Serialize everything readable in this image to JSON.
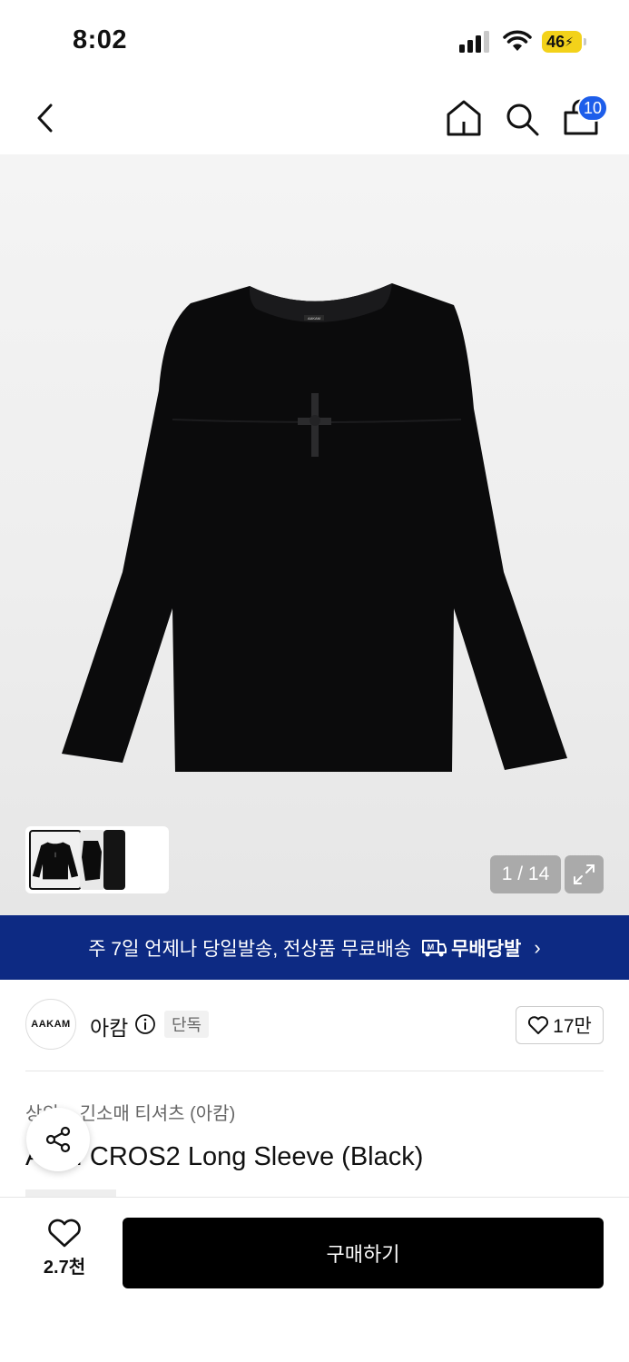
{
  "status_bar": {
    "time": "8:02",
    "battery": "46"
  },
  "nav": {
    "cart_count": "10"
  },
  "gallery": {
    "page_indicator": "1 / 14",
    "shirt_logo": "AAKAM"
  },
  "promo": {
    "text": "주 7일 언제나 당일발송, 전상품 무료배송",
    "badge_label": "무배당발",
    "chevron": "›"
  },
  "brand": {
    "logo_text": "AAKAM",
    "name": "아캄",
    "exclusive_label": "단독",
    "like_count": "17만"
  },
  "product": {
    "breadcrumb": "상의 > 긴소매 티셔츠 (아캄)",
    "title": "AKM CROS2 Long Sleeve (Black)"
  },
  "bottom": {
    "wish_count": "2.7천",
    "buy_label": "구매하기"
  },
  "colors": {
    "accent": "#1e5eea",
    "promo_bg": "#0d2a83",
    "battery": "#f3d21a",
    "primary_button": "#000000"
  }
}
